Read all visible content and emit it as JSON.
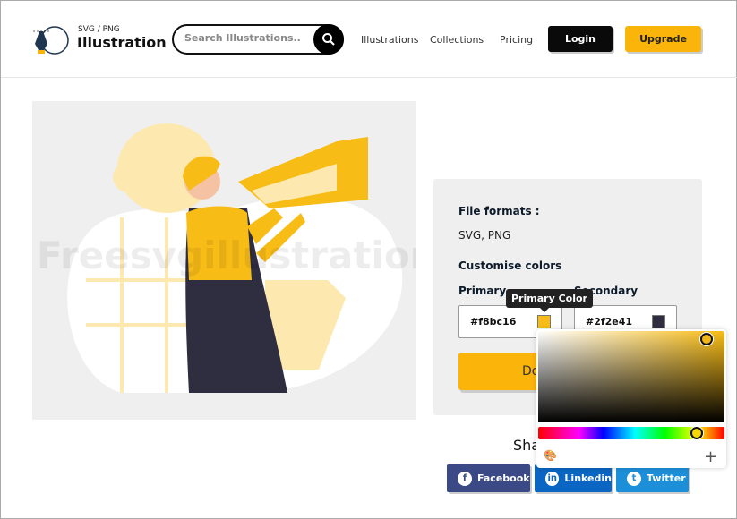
{
  "header": {
    "logo_sub": "SVG / PNG",
    "logo_main": "Illustration",
    "search_placeholder": "Search Illustrations...",
    "nav": [
      "Illustrations",
      "Collections",
      "Pricing"
    ],
    "login": "Login",
    "upgrade": "Upgrade"
  },
  "illustration": {
    "watermark": "Freesvgillustration"
  },
  "panel": {
    "formats_label": "File formats :",
    "formats_value": "SVG, PNG",
    "customise_label": "Customise colors",
    "primary_label": "Primary",
    "secondary_label": "Secondary",
    "primary_value": "#f8bc16",
    "secondary_value": "#2f2e41",
    "tooltip": "Primary Color",
    "download": "Download"
  },
  "share": {
    "heading": "Share",
    "facebook": "Facebook",
    "linkedin": "Linkedin",
    "twitter": "Twitter"
  },
  "colors": {
    "primary": "#f8bc16",
    "secondary": "#2f2e41",
    "accent": "#fbb40a",
    "facebook": "#3b4a87",
    "linkedin": "#0a66c2",
    "twitter": "#1d8fd8"
  }
}
